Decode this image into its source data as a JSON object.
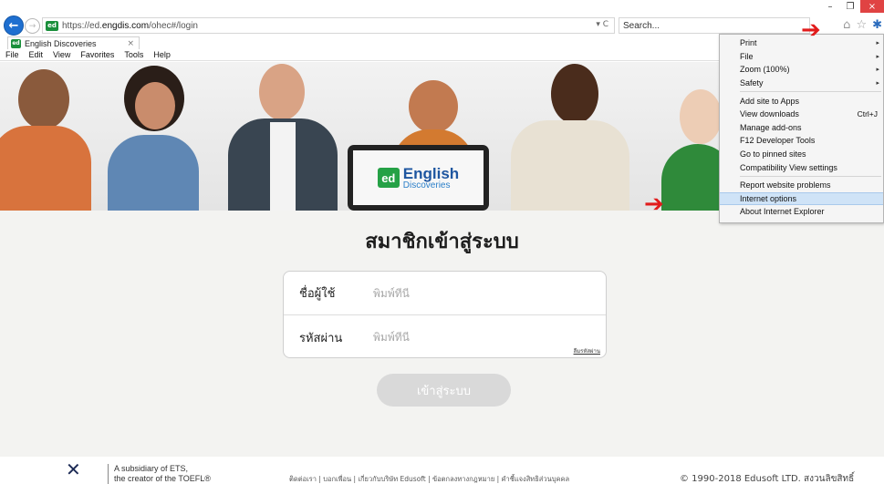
{
  "browser": {
    "url_prefix": "https://ed.",
    "url_domain": "engdis.com",
    "url_path": "/ohec#/login",
    "url_tools": "▾ C",
    "search_placeholder": "Search...",
    "site_icon": "ed",
    "tab_title": "English Discoveries",
    "tab_close": "×",
    "window": {
      "minimize": "–",
      "restore": "❐",
      "close": "×"
    },
    "icons": {
      "back": "back-arrow-icon",
      "forward": "forward-arrow-icon",
      "home": "home-icon",
      "favorites": "star-icon",
      "tools": "gear-icon"
    }
  },
  "menubar": [
    "File",
    "Edit",
    "View",
    "Favorites",
    "Tools",
    "Help"
  ],
  "banner": {
    "logo_letters": "ed",
    "brand_line1": "English",
    "brand_line2": "Discoveries"
  },
  "login": {
    "title": "สมาชิกเข้าสู่ระบบ",
    "username_label": "ชื่อผู้ใช้",
    "username_placeholder": "พิมพ์ที่นี่",
    "password_label": "รหัสผ่าน",
    "password_placeholder": "พิมพ์ที่นี่",
    "forgot_password": "ลืมรหัสผ่าน",
    "submit_label": "เข้าสู่ระบบ"
  },
  "footer": {
    "ets_line1": "A subsidiary of ETS,",
    "ets_line2": "the creator of the TOEFL®",
    "links": "ติดต่อเรา  |  บอกเพื่อน  |  เกี่ยวกับบริษัท Edusoft  |  ข้อตกลงทางกฎหมาย  |  คำชี้แจงสิทธิส่วนบุคคล",
    "copyright": "© 1990-2018 Edusoft LTD. สงวนลิขสิทธิ์"
  },
  "tools_menu": {
    "group1": [
      {
        "label": "Print",
        "submenu": true
      },
      {
        "label": "File",
        "submenu": true
      },
      {
        "label": "Zoom (100%)",
        "submenu": true
      },
      {
        "label": "Safety",
        "submenu": true
      }
    ],
    "group2": [
      {
        "label": "Add site to Apps"
      },
      {
        "label": "View downloads",
        "shortcut": "Ctrl+J"
      },
      {
        "label": "Manage add-ons"
      },
      {
        "label": "F12 Developer Tools"
      },
      {
        "label": "Go to pinned sites"
      },
      {
        "label": "Compatibility View settings"
      }
    ],
    "group3": [
      {
        "label": "Report website problems"
      },
      {
        "label": "Internet options",
        "highlighted": true
      },
      {
        "label": "About Internet Explorer"
      }
    ],
    "submenu_glyph": "▸"
  },
  "colors": {
    "annotation_arrow": "#e11b1b",
    "menu_highlight": "#cfe3f7",
    "brand_green": "#25a146",
    "brand_blue": "#1e56a0"
  }
}
